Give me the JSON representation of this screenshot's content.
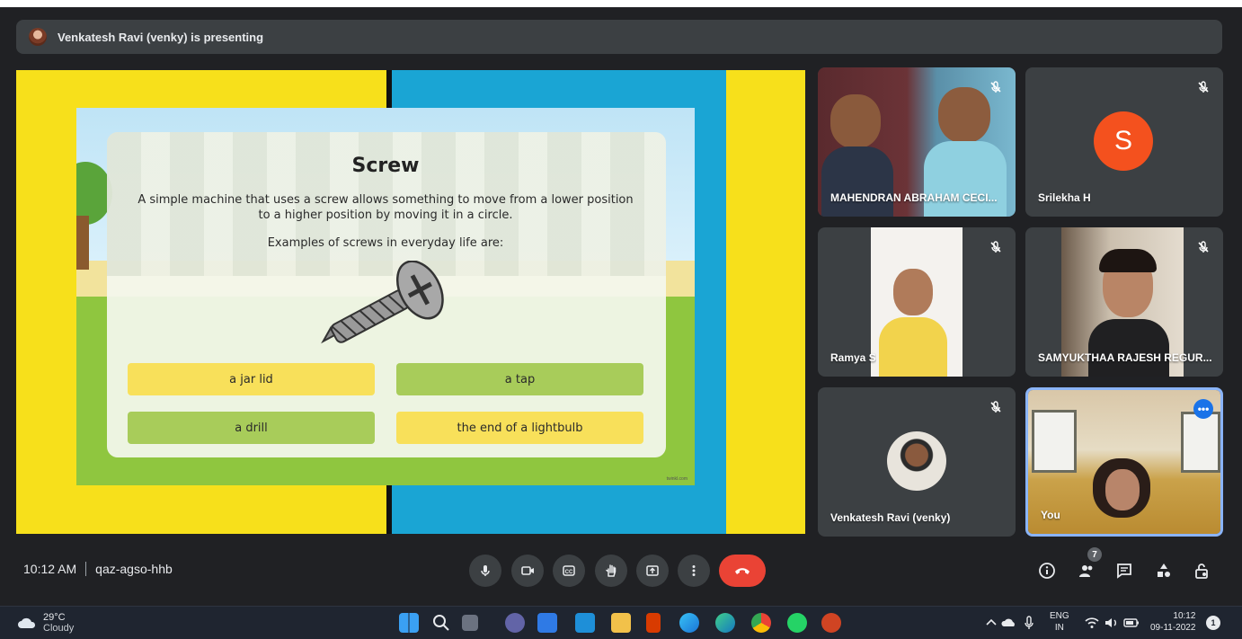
{
  "presenting": {
    "text": "Venkatesh Ravi (venky) is presenting"
  },
  "slide": {
    "title": "Screw",
    "definition": "A simple machine that uses a screw allows something to move from a lower position to a higher position by moving it in a circle.",
    "examples_heading": "Examples of screws in everyday life are:",
    "answers": [
      "a jar lid",
      "a tap",
      "a drill",
      "the end of a lightbulb"
    ],
    "credit": "twinkl.com"
  },
  "participants": [
    {
      "name": "MAHENDRAN ABRAHAM CECI...",
      "muted": true
    },
    {
      "name": "Srilekha H",
      "initial": "S",
      "muted": true
    },
    {
      "name": "Ramya S",
      "muted": true
    },
    {
      "name": "SAMYUKTHAA RAJESH REGUR...",
      "muted": true
    },
    {
      "name": "Venkatesh Ravi (venky)",
      "muted": true
    },
    {
      "name": "You",
      "muted": false
    }
  ],
  "meeting": {
    "time": "10:12 AM",
    "code": "qaz-agso-hhb",
    "participant_count": "7"
  },
  "taskbar": {
    "temperature": "29°C",
    "condition": "Cloudy",
    "lang_top": "ENG",
    "lang_bottom": "IN",
    "clock_time": "10:12",
    "clock_date": "09-11-2022",
    "notification_count": "1"
  },
  "colors": {
    "end_call": "#ea4335",
    "avatar_orange": "#f4511e",
    "self_border": "#8ab4f8"
  },
  "icons": [
    "mic-icon",
    "camera-icon",
    "captions-icon",
    "raise-hand-icon",
    "present-icon",
    "more-options-icon",
    "end-call-icon",
    "info-icon",
    "people-icon",
    "chat-icon",
    "activities-icon",
    "host-controls-icon"
  ]
}
